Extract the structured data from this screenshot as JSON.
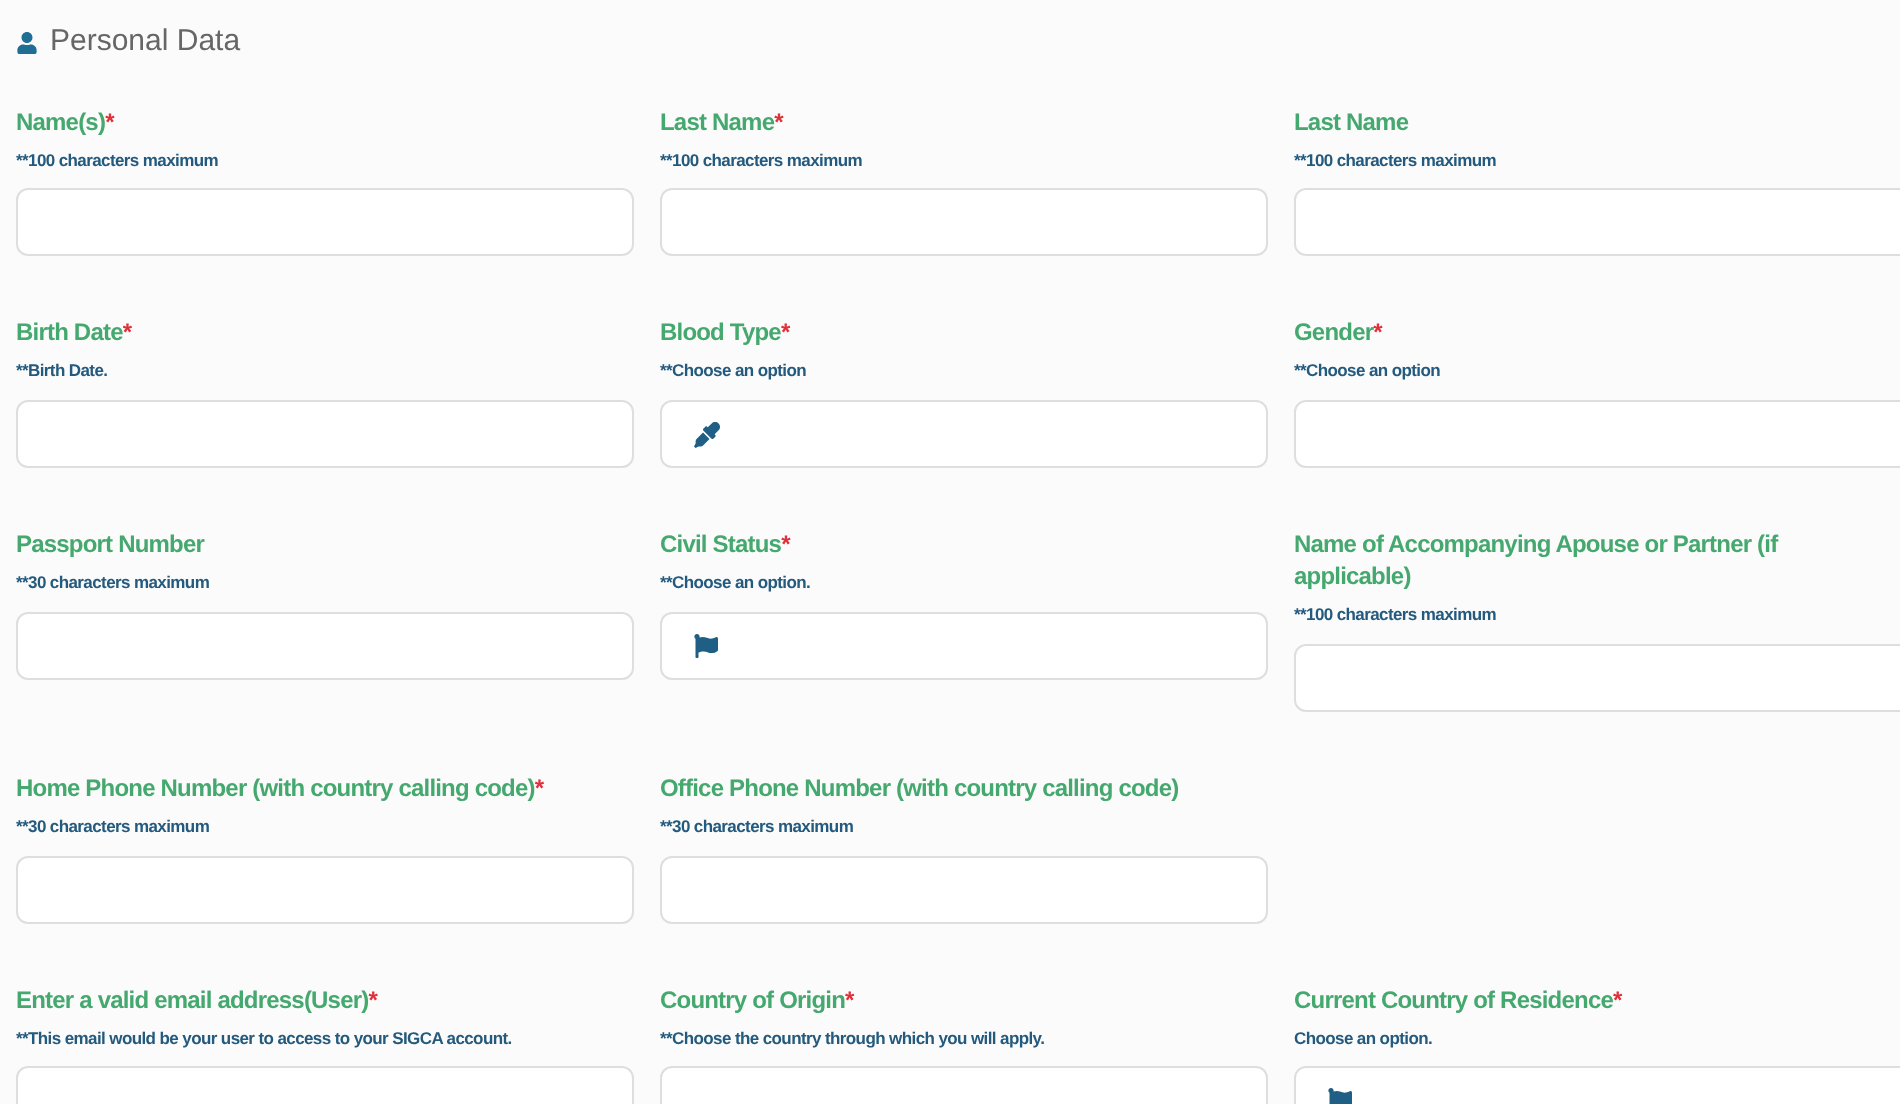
{
  "section": {
    "title": "Personal Data"
  },
  "rows": [
    {
      "fields": [
        {
          "label": "Name(s)",
          "mark": "*",
          "hint": "**100 characters maximum",
          "kind": "plain"
        },
        {
          "label": "Last Name",
          "mark": "*",
          "hint": "**100 characters maximum",
          "kind": "plain"
        },
        {
          "label": "Last Name",
          "hint": "**100 characters maximum",
          "kind": "plain"
        }
      ]
    },
    {
      "fields": [
        {
          "label": "Birth Date",
          "mark": "*",
          "hint": "**Birth Date.",
          "kind": "plain"
        },
        {
          "label": "Blood Type",
          "mark": "*",
          "hint": "**Choose an option",
          "kind": "dropper"
        },
        {
          "label": "Gender",
          "mark": "*",
          "hint": "**Choose an option",
          "kind": "plain"
        }
      ]
    },
    {
      "fields": [
        {
          "label": "Passport Number",
          "hint": "**30 characters maximum",
          "kind": "plain"
        },
        {
          "label": "Civil Status",
          "mark": "*",
          "hint": "**Choose an option.",
          "kind": "flag"
        },
        {
          "label": "Name of Accompanying Apouse or Partner (if applicable)",
          "hint": "**100 characters maximum",
          "kind": "plain"
        }
      ]
    },
    {
      "fields": [
        {
          "label": "Home Phone Number (with country calling code)",
          "mark": "*",
          "hint": "**30 characters maximum",
          "kind": "plain"
        },
        {
          "label": "Office Phone Number (with country calling code)",
          "hint": "**30 characters maximum",
          "kind": "plain"
        }
      ]
    },
    {
      "fields": [
        {
          "label": "Enter a valid email address(User)",
          "mark": "*",
          "hint": "**This email would be your user to access to your SIGCA account.",
          "kind": "plain"
        },
        {
          "label": "Country of Origin",
          "mark": "*",
          "hint": "**Choose the country through which you will apply.",
          "kind": "plain"
        },
        {
          "label": "Current Country of Residence",
          "mark": "*",
          "hint": "Choose an option.",
          "kind": "flag"
        }
      ]
    }
  ]
}
